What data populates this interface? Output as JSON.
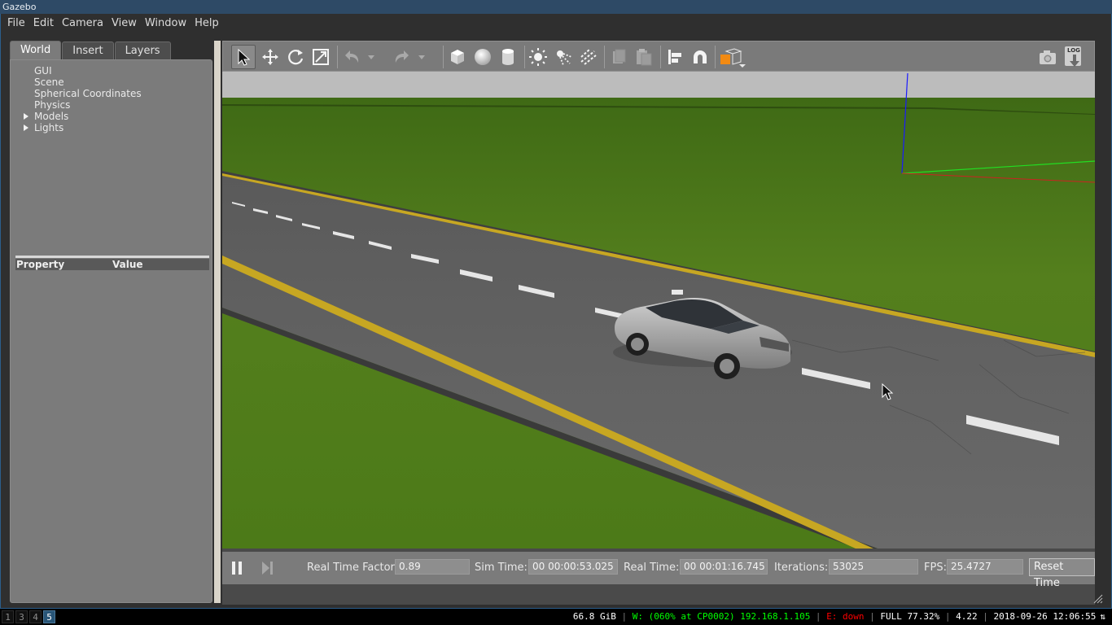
{
  "window": {
    "title": "Gazebo"
  },
  "menu": [
    "File",
    "Edit",
    "Camera",
    "View",
    "Window",
    "Help"
  ],
  "left_panel": {
    "tabs": [
      "World",
      "Insert",
      "Layers"
    ],
    "active_tab": "World",
    "tree": [
      "GUI",
      "Scene",
      "Spherical Coordinates",
      "Physics",
      "Models",
      "Lights"
    ],
    "property_header": {
      "property": "Property",
      "value": "Value"
    }
  },
  "toolbar": {
    "icons": [
      "select-arrow-icon",
      "translate-icon",
      "rotate-icon",
      "scale-icon",
      "undo-icon",
      "undo-dropdown-icon",
      "redo-icon",
      "redo-dropdown-icon",
      "box-icon",
      "sphere-icon",
      "cylinder-icon",
      "point-light-icon",
      "spot-light-icon",
      "directional-light-icon",
      "copy-icon",
      "paste-icon",
      "align-icon",
      "snap-magnet-icon",
      "view-angle-icon",
      "screenshot-camera-icon",
      "log-icon"
    ],
    "log_label": "LOG"
  },
  "bottom_bar": {
    "rtf_label": "Real Time Factor:",
    "rtf_value": "0.89",
    "sim_label": "Sim Time:",
    "sim_value": "00 00:00:53.025",
    "real_label": "Real Time:",
    "real_value": "00 00:01:16.745",
    "iter_label": "Iterations:",
    "iter_value": "53025",
    "fps_label": "FPS:",
    "fps_value": "25.4727",
    "reset_label": "Reset Time"
  },
  "statusbar": {
    "workspaces": [
      "1",
      "3",
      "4",
      "5"
    ],
    "active_workspace": "5",
    "disk": "66.8 GiB",
    "wifi": "W: (060% at CP0002) 192.168.1.105",
    "eth": "E: down",
    "battery": "FULL 77.32%",
    "load": "4.22",
    "datetime": "2018-09-26 12:06:55",
    "colors": {
      "wifi": "#00ff00",
      "eth": "#ff0000",
      "text": "#ffffff",
      "separator": "#777777"
    }
  },
  "colors": {
    "grass": "#4f7a1a",
    "road": "#5b5b5b",
    "lane_yellow": "#c7a722",
    "sky": "#bdbdbd",
    "toolbar": "#7a7a7a",
    "panel": "#7b7b7b",
    "titlebar": "#2e4a66"
  }
}
